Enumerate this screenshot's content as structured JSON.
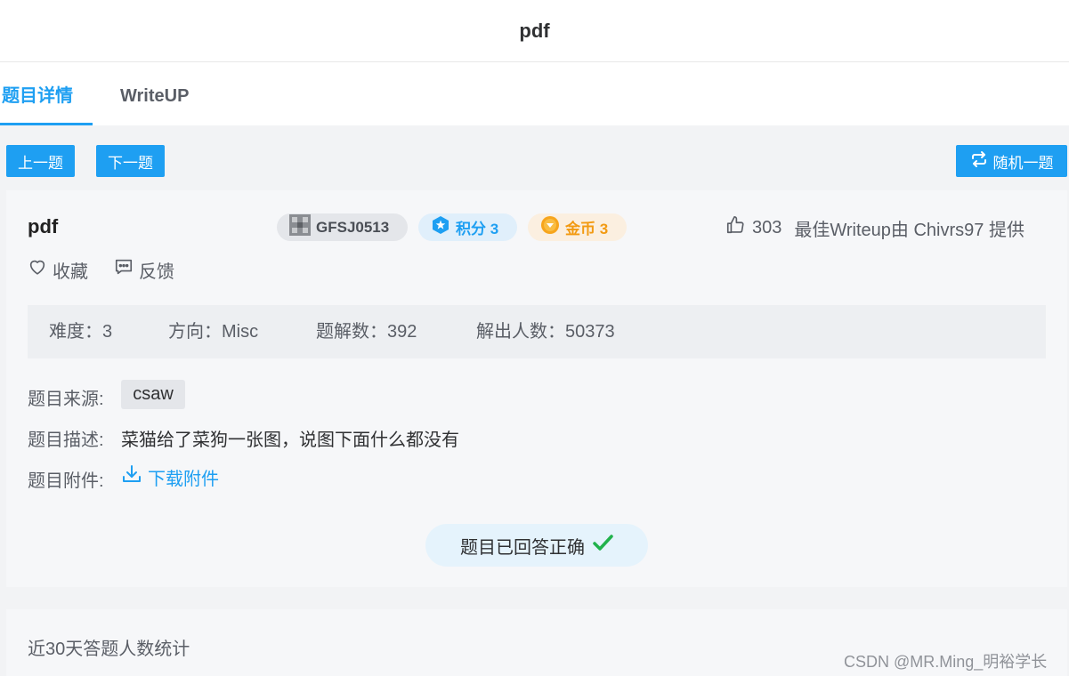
{
  "header": {
    "title": "pdf"
  },
  "tabs": [
    {
      "label": "题目详情",
      "active": true
    },
    {
      "label": "WriteUP",
      "active": false
    }
  ],
  "nav": {
    "prev": "上一题",
    "next": "下一题",
    "random": "随机一题"
  },
  "challenge": {
    "title": "pdf",
    "id": "GFSJ0513",
    "score_label": "积分 3",
    "coin_label": "金币 3",
    "likes": "303",
    "best_writeup": "最佳Writeup由 Chivrs97 提供",
    "favorite": "收藏",
    "feedback": "反馈",
    "stats": {
      "difficulty": "难度：3",
      "direction": "方向：Misc",
      "solutions": "题解数：392",
      "solvers": "解出人数：50373"
    },
    "source_label": "题目来源:",
    "source": "csaw",
    "description_label": "题目描述:",
    "description": "菜猫给了菜狗一张图，说图下面什么都没有",
    "attachment_label": "题目附件:",
    "download": "下载附件",
    "answered": "题目已回答正确"
  },
  "stats_section": {
    "title": "近30天答题人数统计"
  },
  "watermark": "CSDN @MR.Ming_明裕学长",
  "colors": {
    "accent": "#1e9ff2",
    "coin": "#f29a12",
    "success": "#21b24c"
  },
  "icons": {
    "random": "repeat-icon",
    "avatar": "avatar-icon",
    "score": "star-icon",
    "coin": "coin-icon",
    "like": "thumbs-up-icon",
    "favorite": "heart-icon",
    "feedback": "message-icon",
    "download": "download-icon",
    "check": "check-icon"
  }
}
